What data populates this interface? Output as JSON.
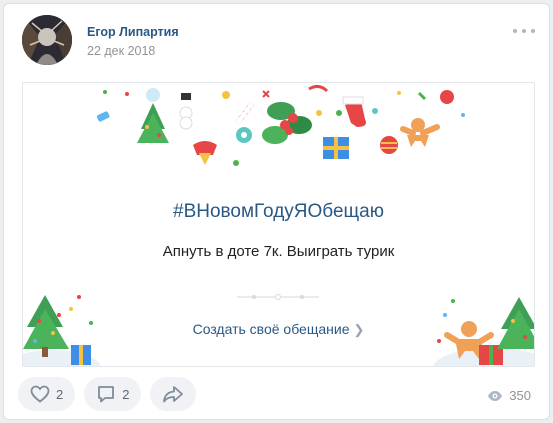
{
  "post": {
    "author": "Егор Липартия",
    "date": "22 дек 2018"
  },
  "card": {
    "hashtag": "#ВНовомГодуЯОбещаю",
    "promise": "Апнуть в доте 7к. Выиграть турик",
    "cta": "Создать своё обещание"
  },
  "actions": {
    "likes": "2",
    "comments": "2",
    "views": "350"
  },
  "colors": {
    "link": "#2a5885",
    "muted": "#939393",
    "action_bg": "#f0f2f5"
  },
  "icons": [
    "more-icon",
    "heart-icon",
    "comment-icon",
    "share-icon",
    "eye-icon",
    "chevron-right-icon"
  ]
}
